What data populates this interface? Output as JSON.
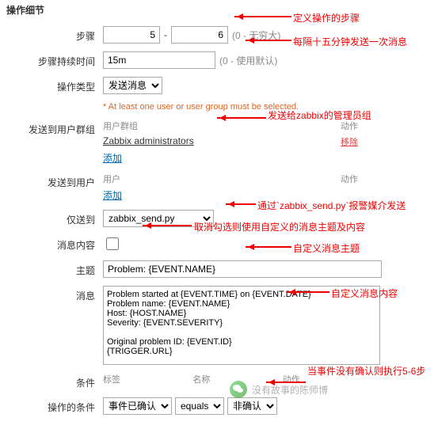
{
  "section_title": "操作细节",
  "labels": {
    "steps": "步骤",
    "duration": "步骤持续时间",
    "op_type": "操作类型",
    "send_groups": "发送到用户群组",
    "send_users": "发送到用户",
    "send_only": "仅送到",
    "msg_content_chk": "消息内容",
    "subject": "主题",
    "message": "消息",
    "conditions": "条件",
    "op_conditions": "操作的条件"
  },
  "steps": {
    "from": "5",
    "to": "6",
    "inf": "(0 - 无穷大)"
  },
  "duration": {
    "value": "15m",
    "inf": "(0 - 使用默认)"
  },
  "op_type": {
    "selected": "发送消息"
  },
  "required_note": "* At least one user or user group must be selected.",
  "groups_tbl": {
    "h1": "用户群组",
    "h2": "动作",
    "row": "Zabbix administrators",
    "remove": "移除",
    "add": "添加"
  },
  "users_tbl": {
    "h1": "用户",
    "h2": "动作",
    "add": "添加"
  },
  "send_only": {
    "selected": "zabbix_send.py"
  },
  "default_msg_checked": false,
  "subject": "Problem: {EVENT.NAME}",
  "message": "Problem started at {EVENT.TIME} on {EVENT.DATE}\nProblem name: {EVENT.NAME}\nHost: {HOST.NAME}\nSeverity: {EVENT.SEVERITY}\n\nOriginal problem ID: {EVENT.ID}\n{TRIGGER.URL}",
  "cond_headers": {
    "tag": "标签",
    "name": "名称",
    "action": "动作"
  },
  "op_cond": {
    "field": "事件已确认",
    "op": "equals",
    "val": "非确认"
  },
  "annotations": {
    "a1": "定义操作的步骤",
    "a2": "每隔十五分钟发送一次消息",
    "a3": "发送给zabbix的管理员组",
    "a4": "通过`zabbix_send.py`报警媒介发送",
    "a5": "取消勾选则使用自定义的消息主题及内容",
    "a6": "自定义消息主题",
    "a7": "自定义消息内容",
    "a8": "当事件没有确认则执行5-6步"
  },
  "wechat": "没有故事的陈师博"
}
